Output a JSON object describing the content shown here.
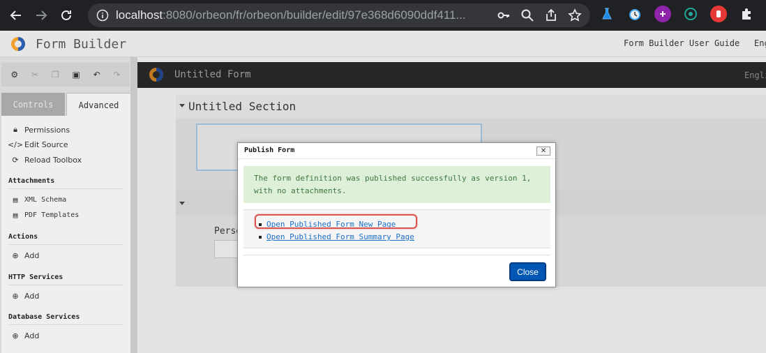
{
  "browser": {
    "url_host": "localhost",
    "url_rest": ":8080/orbeon/fr/orbeon/builder/edit/97e368d6090ddf411..."
  },
  "app": {
    "title": "Form Builder",
    "guide_link": "Form Builder User Guide",
    "language": "Eng"
  },
  "toolbox": {
    "tabs": [
      "Controls",
      "Advanced"
    ],
    "active_tab": "Advanced",
    "items": {
      "permissions": "Permissions",
      "edit_source": "Edit Source",
      "reload_toolbox": "Reload Toolbox"
    },
    "groups": {
      "attachments": "Attachments",
      "xml_schema": "XML Schema",
      "pdf_templates": "PDF Templates",
      "actions": "Actions",
      "actions_add": "Add",
      "http_services": "HTTP Services",
      "http_add": "Add",
      "database_services": "Database Services",
      "db_add": "Add"
    }
  },
  "form": {
    "title": "Untitled Form",
    "language": "Engli",
    "section_title": "Untitled Section",
    "field_label": "Perso"
  },
  "dialog": {
    "title": "Publish Form",
    "close_x": "✕",
    "message": "The form definition was published successfully as version 1, with no attachments.",
    "link_new": "Open Published Form New Page",
    "link_summary": "Open Published Form Summary Page",
    "close_button": "Close"
  },
  "colors": {
    "success_bg": "#dff0d8",
    "success_text": "#3c763d",
    "link": "#1a6fc9",
    "primary_button": "#0056b3",
    "highlight": "#d9534f"
  }
}
